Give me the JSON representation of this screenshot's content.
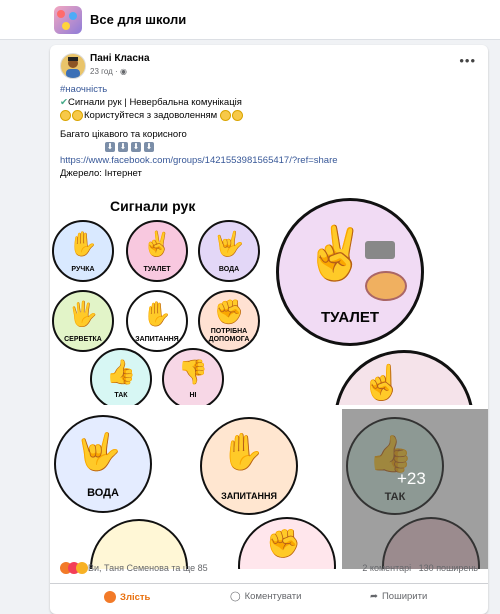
{
  "header": {
    "group_title": "Все для школи"
  },
  "post": {
    "author": "Пані Класна",
    "time": "23 год",
    "hashtag": "#наочність",
    "line1": "Сигнали рук | Невербальна комунікація",
    "line2": "Користуйтеся  з задоволенням",
    "line3": "Багато цікавого та корисного",
    "url": "https://www.facebook.com/groups/1421553981565417/?ref=share",
    "source": "Джерело: Інтернет"
  },
  "media": {
    "sheet_title": "Сигнали рук",
    "labels": {
      "pen": "РУЧКА",
      "toilet": "ТУАЛЕТ",
      "water": "ВОДА",
      "napkin": "СЕРВЕТКА",
      "question": "ЗАПИТАННЯ",
      "help1": "ПОТРІБНА",
      "help2": "ДОПОМОГА",
      "yes": "ТАК",
      "no": "НІ"
    },
    "more_count": "+23"
  },
  "stats": {
    "reactions": "Ви, Таня Семенова та ще 85",
    "comments": "2 коментарі",
    "shares": "130 поширень"
  },
  "actions": {
    "like": "Злість",
    "comment": "Коментувати",
    "share": "Поширити"
  },
  "colors": {
    "link": "#385898",
    "angry": "#e9710f"
  }
}
